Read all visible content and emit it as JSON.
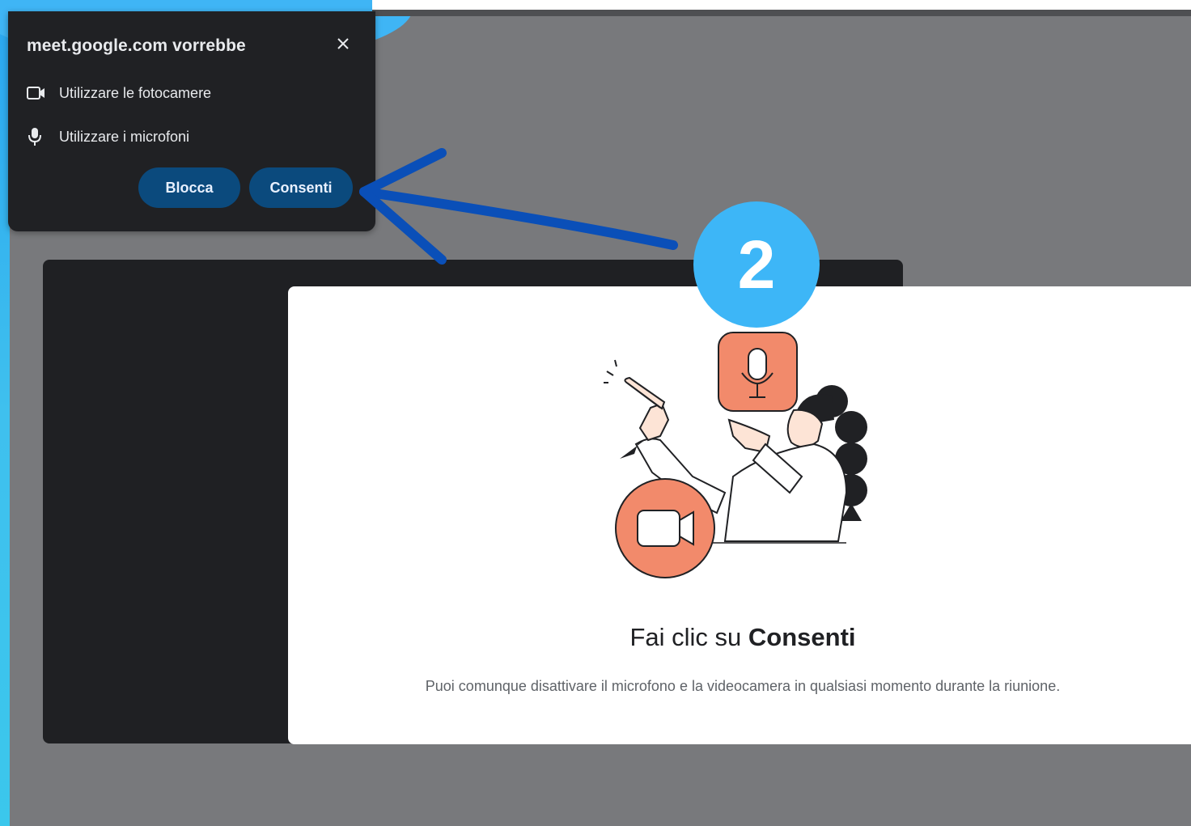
{
  "prompt": {
    "title": "meet.google.com vorrebbe",
    "permissions": [
      {
        "icon": "camera-icon",
        "label": "Utilizzare le fotocamere"
      },
      {
        "icon": "microphone-icon",
        "label": "Utilizzare i microfoni"
      }
    ],
    "block_label": "Blocca",
    "allow_label": "Consenti"
  },
  "card": {
    "heading_prefix": "Fai clic su ",
    "heading_bold": "Consenti",
    "description": "Puoi comunque disattivare il microfono e la videocamera in qualsiasi momento durante la riunione."
  },
  "annotation": {
    "step_number": "2",
    "accent_color": "#3db6f7",
    "arrow_color": "#0a4fb8"
  },
  "colors": {
    "illustration_accent": "#f28a6b"
  }
}
